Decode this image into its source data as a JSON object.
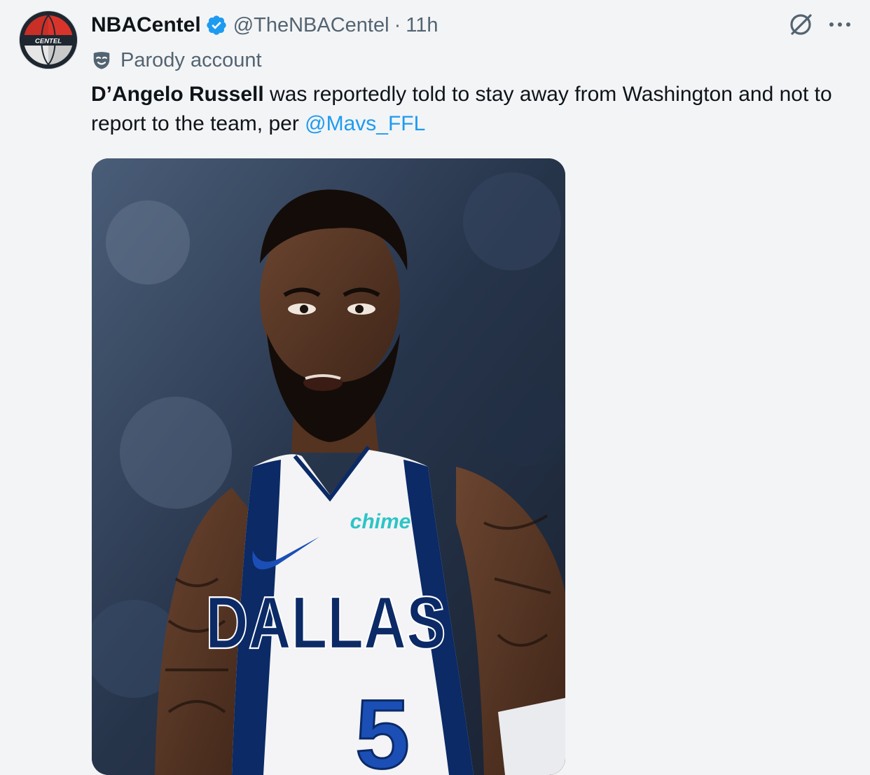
{
  "author": {
    "display_name": "NBACentel",
    "handle": "@TheNBACentel",
    "separator": "·",
    "time": "11h",
    "verified": true,
    "label": "Parody account",
    "avatar_text": "CENTEL"
  },
  "tweet": {
    "text_bold": "D’Angelo Russell",
    "text_rest": " was reportedly told to stay away from Washington and not to report to the team, per ",
    "mention": "@Mavs_FFL"
  },
  "media": {
    "jersey_sponsor": "chime",
    "jersey_team": "DALLAS",
    "jersey_number": "5"
  },
  "icons": {
    "grok": "grok-icon",
    "more": "more-horizontal-icon",
    "verified": "verified-badge-icon",
    "parody": "parody-mask-icon"
  },
  "colors": {
    "link": "#1d9bf0",
    "verified": "#1d9bf0",
    "secondary_text": "#536471",
    "jersey_navy": "#0b2a66",
    "sponsor_teal": "#2ec4c6"
  }
}
